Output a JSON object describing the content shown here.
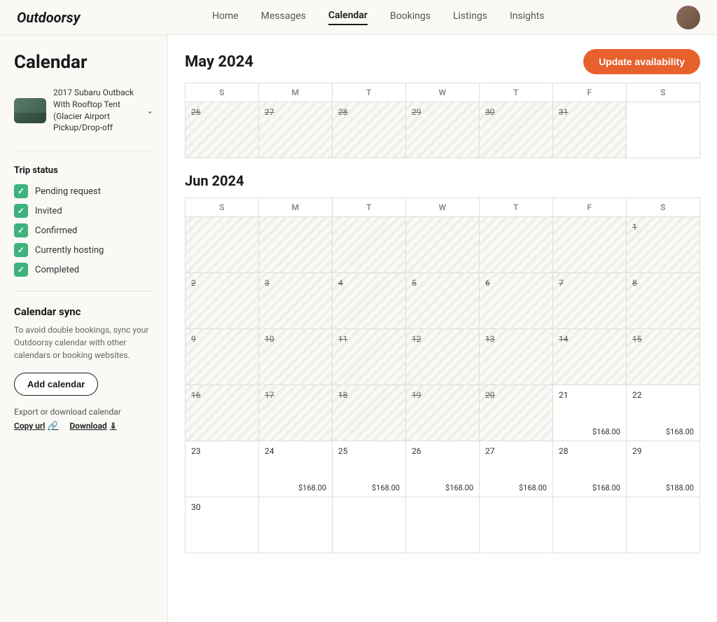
{
  "header": {
    "logo": "Outdoorsy",
    "nav": [
      {
        "label": "Home",
        "active": false
      },
      {
        "label": "Messages",
        "active": false
      },
      {
        "label": "Calendar",
        "active": true
      },
      {
        "label": "Bookings",
        "active": false
      },
      {
        "label": "Listings",
        "active": false
      },
      {
        "label": "Insights",
        "active": false
      }
    ]
  },
  "sidebar": {
    "title": "Calendar",
    "vehicle": {
      "name": "2017 Subaru Outback With Rooftop Tent (Glacier Airport Pickup/Drop-off"
    },
    "trip_status": {
      "label": "Trip status",
      "items": [
        {
          "label": "Pending request"
        },
        {
          "label": "Invited"
        },
        {
          "label": "Confirmed"
        },
        {
          "label": "Currently hosting"
        },
        {
          "label": "Completed"
        }
      ]
    },
    "calendar_sync": {
      "title": "Calendar sync",
      "description": "To avoid double bookings, sync your Outdoorsy calendar with other calendars or booking websites.",
      "add_button": "Add calendar",
      "export_label": "Export or download calendar",
      "copy_url_label": "Copy url",
      "download_label": "Download"
    }
  },
  "calendar": {
    "update_button": "Update availability",
    "may_2024": {
      "month_label": "May 2024",
      "dow": [
        "S",
        "M",
        "T",
        "W",
        "T",
        "F",
        "S"
      ],
      "rows": [
        [
          {
            "day": "26",
            "available": false,
            "price": null
          },
          {
            "day": "27",
            "available": false,
            "price": null
          },
          {
            "day": "28",
            "available": false,
            "price": null
          },
          {
            "day": "29",
            "available": false,
            "price": null
          },
          {
            "day": "30",
            "available": false,
            "price": null
          },
          {
            "day": "31",
            "available": false,
            "price": null
          },
          {
            "day": "",
            "available": false,
            "price": null,
            "empty": true
          }
        ]
      ]
    },
    "jun_2024": {
      "month_label": "Jun 2024",
      "dow": [
        "S",
        "M",
        "T",
        "W",
        "T",
        "F",
        "S"
      ],
      "rows": [
        [
          {
            "day": "",
            "available": false,
            "price": null,
            "empty": true
          },
          {
            "day": "",
            "available": false,
            "price": null,
            "empty": true
          },
          {
            "day": "",
            "available": false,
            "price": null,
            "empty": true
          },
          {
            "day": "",
            "available": false,
            "price": null,
            "empty": true
          },
          {
            "day": "",
            "available": false,
            "price": null,
            "empty": true
          },
          {
            "day": "",
            "available": false,
            "price": null,
            "empty": true
          },
          {
            "day": "1",
            "available": false,
            "price": null
          }
        ],
        [
          {
            "day": "2",
            "available": false,
            "price": null
          },
          {
            "day": "3",
            "available": false,
            "price": null
          },
          {
            "day": "4",
            "available": false,
            "price": null
          },
          {
            "day": "5",
            "available": false,
            "price": null
          },
          {
            "day": "6",
            "available": false,
            "price": null
          },
          {
            "day": "7",
            "available": false,
            "price": null
          },
          {
            "day": "8",
            "available": false,
            "price": null
          }
        ],
        [
          {
            "day": "9",
            "available": false,
            "price": null
          },
          {
            "day": "10",
            "available": false,
            "price": null
          },
          {
            "day": "11",
            "available": false,
            "price": null
          },
          {
            "day": "12",
            "available": false,
            "price": null
          },
          {
            "day": "13",
            "available": false,
            "price": null
          },
          {
            "day": "14",
            "available": false,
            "price": null
          },
          {
            "day": "15",
            "available": false,
            "price": null
          }
        ],
        [
          {
            "day": "16",
            "available": false,
            "price": null
          },
          {
            "day": "17",
            "available": false,
            "price": null
          },
          {
            "day": "18",
            "available": false,
            "price": null
          },
          {
            "day": "19",
            "available": false,
            "price": null
          },
          {
            "day": "20",
            "available": false,
            "price": null
          },
          {
            "day": "21",
            "available": true,
            "price": "$168.00"
          },
          {
            "day": "22",
            "available": true,
            "price": "$168.00"
          }
        ],
        [
          {
            "day": "23",
            "available": true,
            "price": null
          },
          {
            "day": "24",
            "available": true,
            "price": "$168.00"
          },
          {
            "day": "25",
            "available": true,
            "price": "$168.00"
          },
          {
            "day": "26",
            "available": true,
            "price": "$168.00"
          },
          {
            "day": "27",
            "available": true,
            "price": "$168.00"
          },
          {
            "day": "28",
            "available": true,
            "price": "$168.00"
          },
          {
            "day": "29",
            "available": true,
            "price": "$188.00"
          }
        ],
        [
          {
            "day": "30",
            "available": true,
            "price": null
          },
          {
            "day": "",
            "available": false,
            "price": null,
            "empty": true
          },
          {
            "day": "",
            "available": false,
            "price": null,
            "empty": true
          },
          {
            "day": "",
            "available": false,
            "price": null,
            "empty": true
          },
          {
            "day": "",
            "available": false,
            "price": null,
            "empty": true
          },
          {
            "day": "",
            "available": false,
            "price": null,
            "empty": true
          },
          {
            "day": "",
            "available": false,
            "price": null,
            "empty": true
          }
        ]
      ]
    }
  }
}
